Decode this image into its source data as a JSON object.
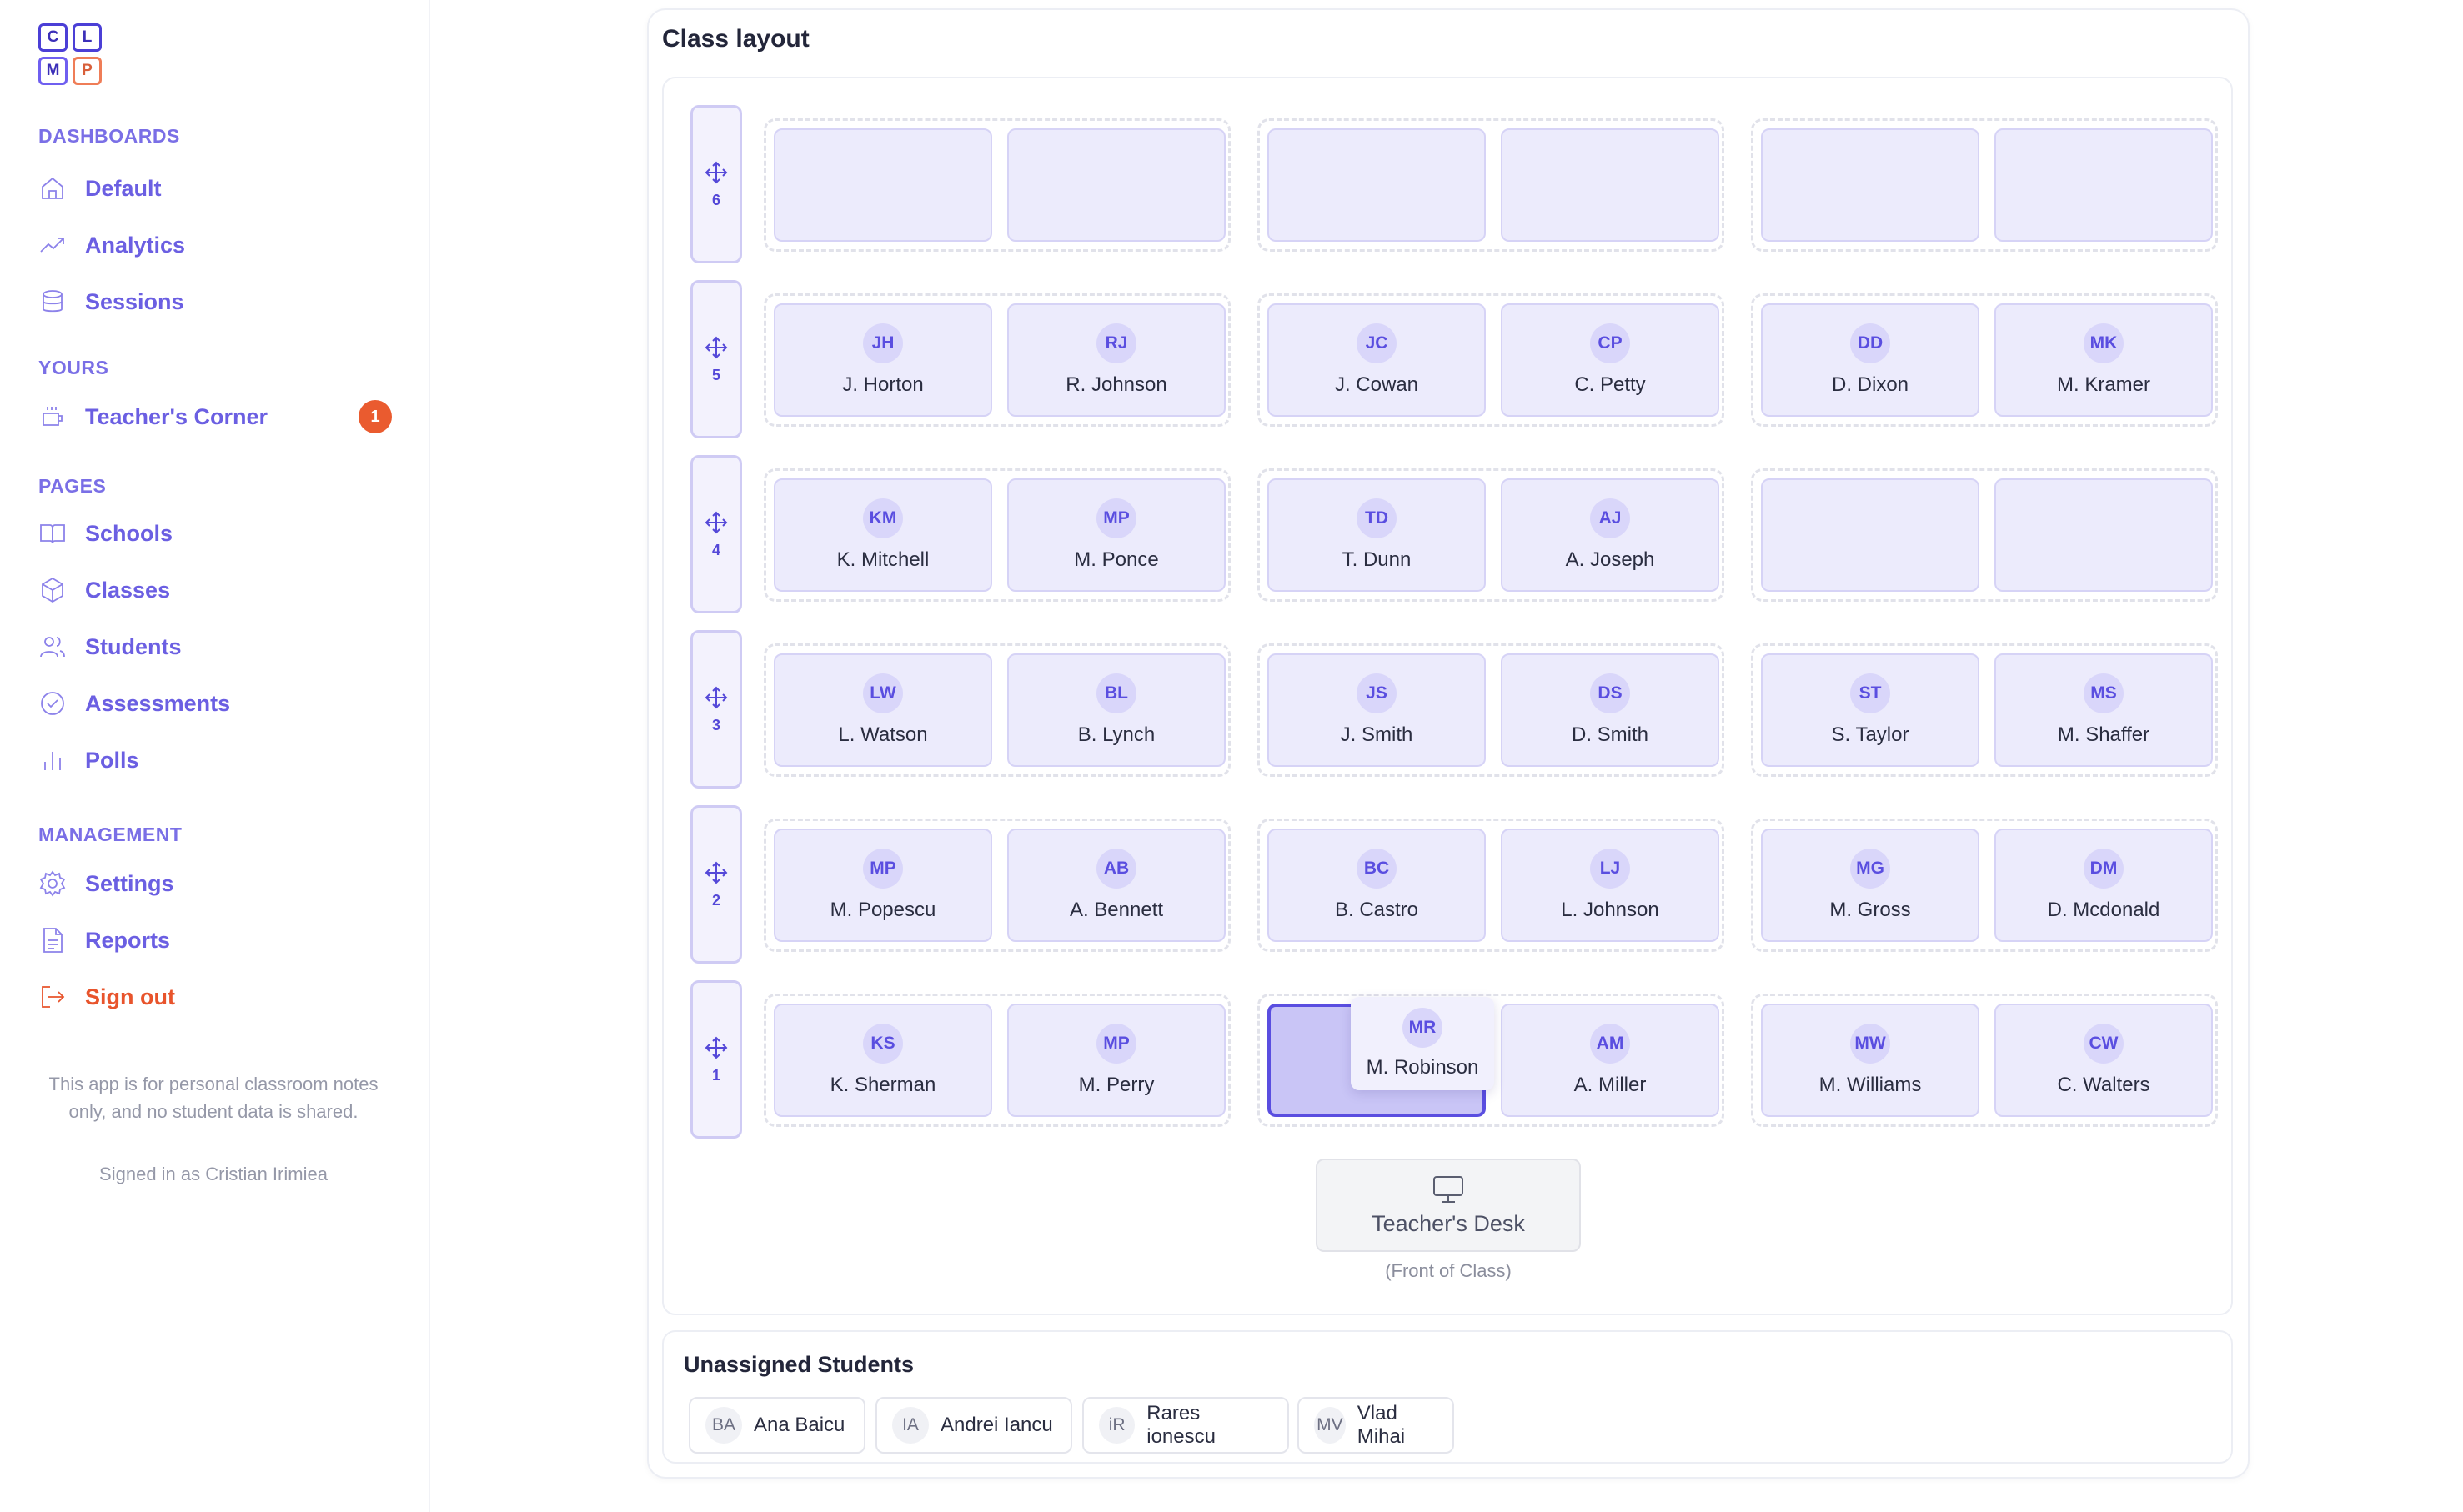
{
  "logo": [
    "C",
    "L",
    "M",
    "P"
  ],
  "sidebar": {
    "sections": [
      {
        "title": "DASHBOARDS",
        "items": [
          {
            "label": "Default",
            "icon": "home-icon"
          },
          {
            "label": "Analytics",
            "icon": "trend-icon"
          },
          {
            "label": "Sessions",
            "icon": "database-icon"
          }
        ]
      },
      {
        "title": "YOURS",
        "items": [
          {
            "label": "Teacher's Corner",
            "icon": "coffee-icon",
            "badge": "1"
          }
        ]
      },
      {
        "title": "PAGES",
        "items": [
          {
            "label": "Schools",
            "icon": "book-icon"
          },
          {
            "label": "Classes",
            "icon": "cube-icon"
          },
          {
            "label": "Students",
            "icon": "users-icon"
          },
          {
            "label": "Assessments",
            "icon": "check-circle-icon"
          },
          {
            "label": "Polls",
            "icon": "bar-chart-icon"
          }
        ]
      },
      {
        "title": "MANAGEMENT",
        "items": [
          {
            "label": "Settings",
            "icon": "gear-icon"
          },
          {
            "label": "Reports",
            "icon": "file-icon"
          },
          {
            "label": "Sign out",
            "icon": "logout-icon"
          }
        ]
      }
    ],
    "note": "This app is for personal classroom notes only, and no student data is shared.",
    "signed_in": "Signed in as Cristian Irimiea"
  },
  "main": {
    "title": "Class layout",
    "rows": [
      {
        "number": "6",
        "seats": [
          {
            "initials": "",
            "name": ""
          },
          {
            "initials": "",
            "name": ""
          },
          {
            "initials": "",
            "name": ""
          },
          {
            "initials": "",
            "name": ""
          },
          {
            "initials": "",
            "name": ""
          },
          {
            "initials": "",
            "name": ""
          }
        ]
      },
      {
        "number": "5",
        "seats": [
          {
            "initials": "JH",
            "name": "J. Horton"
          },
          {
            "initials": "RJ",
            "name": "R. Johnson"
          },
          {
            "initials": "JC",
            "name": "J. Cowan"
          },
          {
            "initials": "CP",
            "name": "C. Petty"
          },
          {
            "initials": "DD",
            "name": "D. Dixon"
          },
          {
            "initials": "MK",
            "name": "M. Kramer"
          }
        ]
      },
      {
        "number": "4",
        "seats": [
          {
            "initials": "KM",
            "name": "K. Mitchell"
          },
          {
            "initials": "MP",
            "name": "M. Ponce"
          },
          {
            "initials": "TD",
            "name": "T. Dunn"
          },
          {
            "initials": "AJ",
            "name": "A. Joseph"
          },
          {
            "initials": "",
            "name": ""
          },
          {
            "initials": "",
            "name": ""
          }
        ]
      },
      {
        "number": "3",
        "seats": [
          {
            "initials": "LW",
            "name": "L. Watson"
          },
          {
            "initials": "BL",
            "name": "B. Lynch"
          },
          {
            "initials": "JS",
            "name": "J. Smith"
          },
          {
            "initials": "DS",
            "name": "D. Smith"
          },
          {
            "initials": "ST",
            "name": "S. Taylor"
          },
          {
            "initials": "MS",
            "name": "M. Shaffer"
          }
        ]
      },
      {
        "number": "2",
        "seats": [
          {
            "initials": "MP",
            "name": "M. Popescu"
          },
          {
            "initials": "AB",
            "name": "A. Bennett"
          },
          {
            "initials": "BC",
            "name": "B. Castro"
          },
          {
            "initials": "LJ",
            "name": "L. Johnson"
          },
          {
            "initials": "MG",
            "name": "M. Gross"
          },
          {
            "initials": "DM",
            "name": "D. Mcdonald"
          }
        ]
      },
      {
        "number": "1",
        "seats": [
          {
            "initials": "KS",
            "name": "K. Sherman"
          },
          {
            "initials": "MP",
            "name": "M. Perry"
          },
          {
            "initials": "",
            "name": "",
            "drop_target": true
          },
          {
            "initials": "AM",
            "name": "A. Miller"
          },
          {
            "initials": "MW",
            "name": "M. Williams"
          },
          {
            "initials": "CW",
            "name": "C. Walters"
          }
        ]
      }
    ],
    "dragging": {
      "initials": "MR",
      "name": "M. Robinson"
    },
    "teacher_desk": {
      "label": "Teacher's Desk",
      "sub": "(Front of Class)"
    }
  },
  "unassigned": {
    "title": "Unassigned Students",
    "students": [
      {
        "initials": "BA",
        "name": "Ana Baicu"
      },
      {
        "initials": "IA",
        "name": "Andrei Iancu"
      },
      {
        "initials": "iR",
        "name": "Rares ionescu"
      },
      {
        "initials": "MV",
        "name": "Vlad Mihai"
      }
    ]
  }
}
